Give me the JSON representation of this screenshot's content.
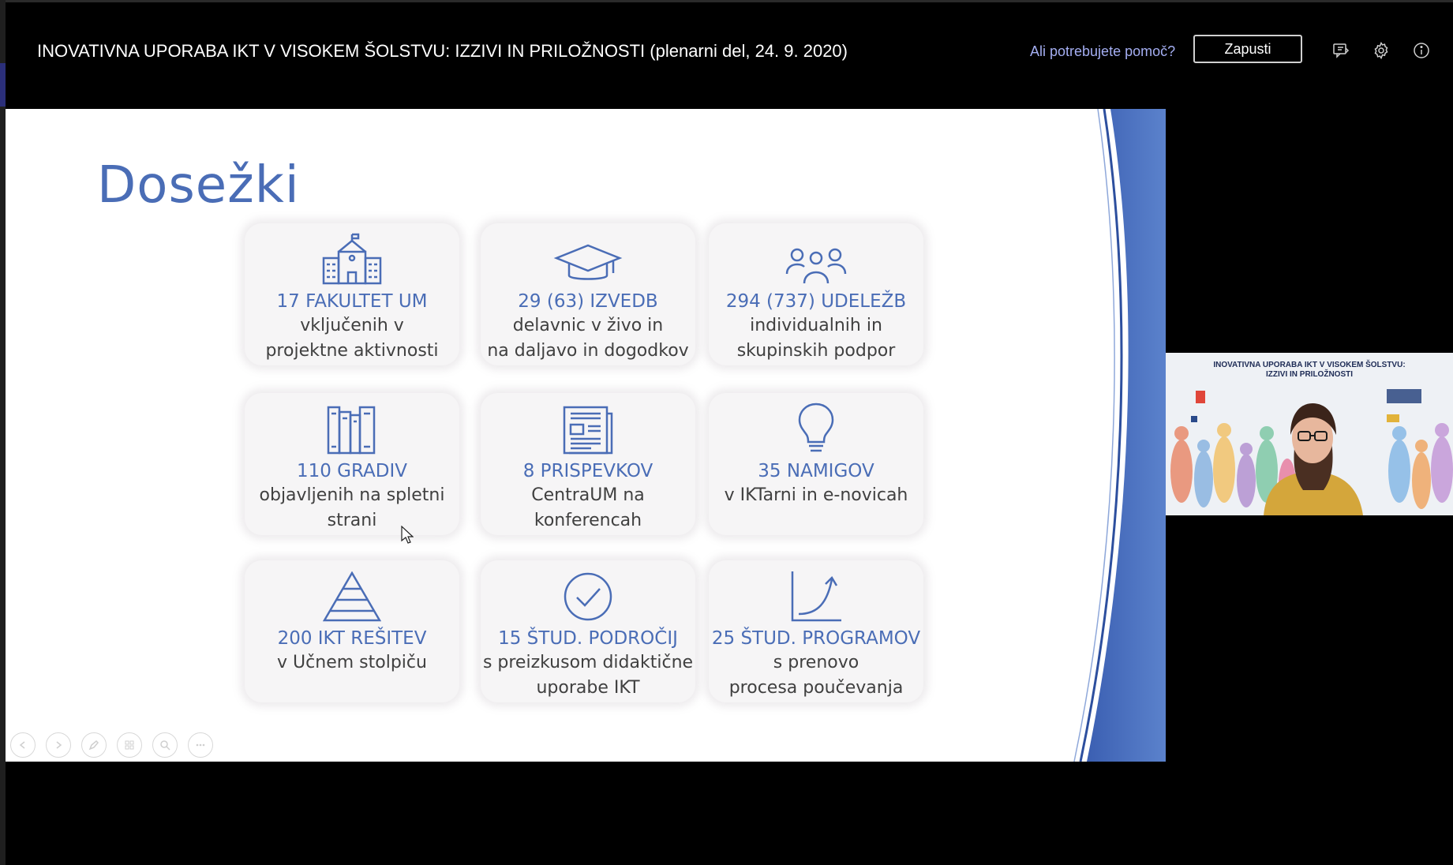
{
  "meeting": {
    "title": "INOVATIVNA UPORABA IKT V VISOKEM ŠOLSTVU: IZZIVI IN PRILOŽNOSTI (plenarni del, 24. 9. 2020)",
    "help_link": "Ali potrebujete pomoč?",
    "leave_label": "Zapusti",
    "header_icons": [
      "feedback-icon",
      "gear-icon",
      "info-icon"
    ]
  },
  "slide": {
    "title": "Dosežki",
    "accent_color": "#4a6db6",
    "cards": [
      {
        "icon": "school-building-icon",
        "highlight": "17 FAKULTET UM",
        "description": "vključenih v\nprojektne aktivnosti"
      },
      {
        "icon": "graduation-cap-icon",
        "highlight": "29 (63) IZVEDB",
        "description": "delavnic v živo in\nna daljavo in dogodkov"
      },
      {
        "icon": "people-group-icon",
        "highlight": "294 (737) UDELEŽB",
        "description": "individualnih in\nskupinskih podpor"
      },
      {
        "icon": "books-icon",
        "highlight": "110 GRADIV",
        "description": "objavljenih na spletni\nstrani"
      },
      {
        "icon": "newspaper-icon",
        "highlight": "8 PRISPEVKOV",
        "description": "CentraUM na\nkonferencah"
      },
      {
        "icon": "lightbulb-icon",
        "highlight": "35 NAMIGOV",
        "description": "v IKTarni in e-novicah"
      },
      {
        "icon": "pyramid-icon",
        "highlight": "200 IKT REŠITEV",
        "description": "v Učnem stolpiču"
      },
      {
        "icon": "checkmark-circle-icon",
        "highlight": "15 ŠTUD. PODROČIJ",
        "description": "s preizkusom didaktične\nuporabe IKT"
      },
      {
        "icon": "growth-chart-icon",
        "highlight": "25 ŠTUD. PROGRAMOV",
        "description": "s prenovo\nprocesa poučevanja"
      }
    ],
    "controls": [
      "previous-slide-icon",
      "next-slide-icon",
      "pen-icon",
      "slides-grid-icon",
      "zoom-icon",
      "more-options-icon"
    ]
  },
  "video": {
    "banner_title_line1": "INOVATIVNA UPORABA IKT V VISOKEM ŠOLSTVU:",
    "banner_title_line2": "IZZIVI IN PRILOŽNOSTI"
  }
}
